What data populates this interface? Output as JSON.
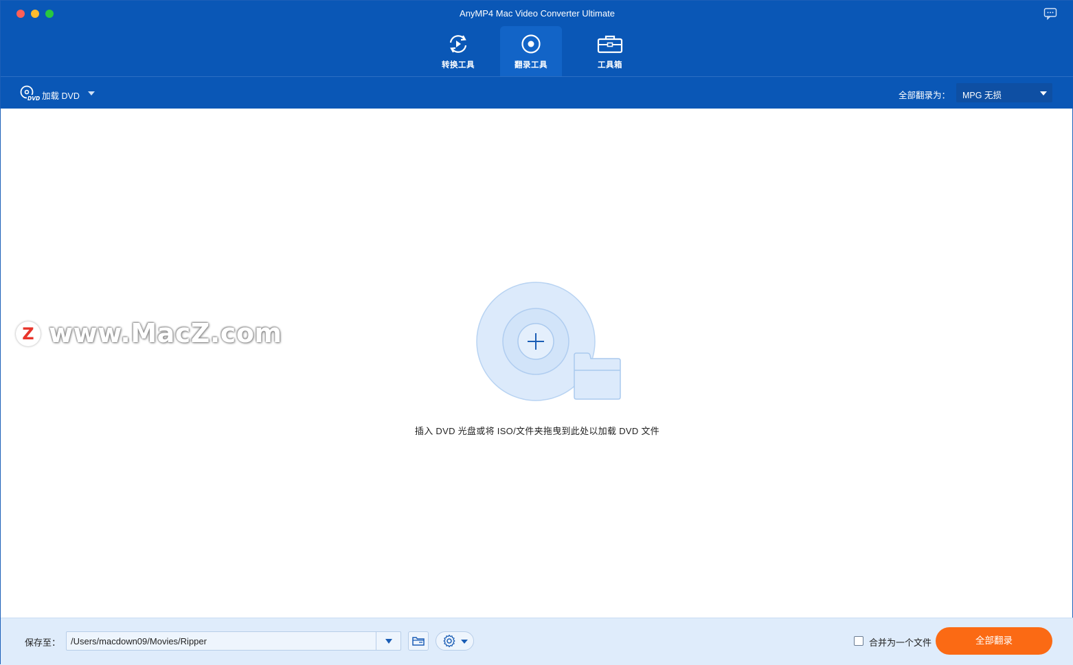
{
  "window": {
    "title": "AnyMP4 Mac Video Converter Ultimate"
  },
  "tabs": [
    {
      "label": "转换工具",
      "icon": "convert-icon",
      "active": false
    },
    {
      "label": "翻录工具",
      "icon": "disc-rip-icon",
      "active": true
    },
    {
      "label": "工具箱",
      "icon": "toolbox-icon",
      "active": false
    }
  ],
  "toolbar": {
    "load_dvd_label": "加载 DVD",
    "rip_all_to_label": "全部翻录为：",
    "format_value": "MPG 无损"
  },
  "main": {
    "drop_hint": "插入 DVD 光盘或将 ISO/文件夹拖曳到此处以加载 DVD 文件"
  },
  "watermark": {
    "logo_letter": "Z",
    "text": "www.MacZ.com"
  },
  "footer": {
    "save_to_label": "保存至：",
    "path_value": "/Users/macdown09/Movies/Ripper",
    "merge_label": "合并为一个文件",
    "merge_checked": false,
    "rip_all_button": "全部翻录"
  },
  "colors": {
    "header_bg": "#0a57b6",
    "active_tab_bg": "#1264c7",
    "footer_bg": "#dfecfb",
    "primary_button": "#fb6a14"
  }
}
